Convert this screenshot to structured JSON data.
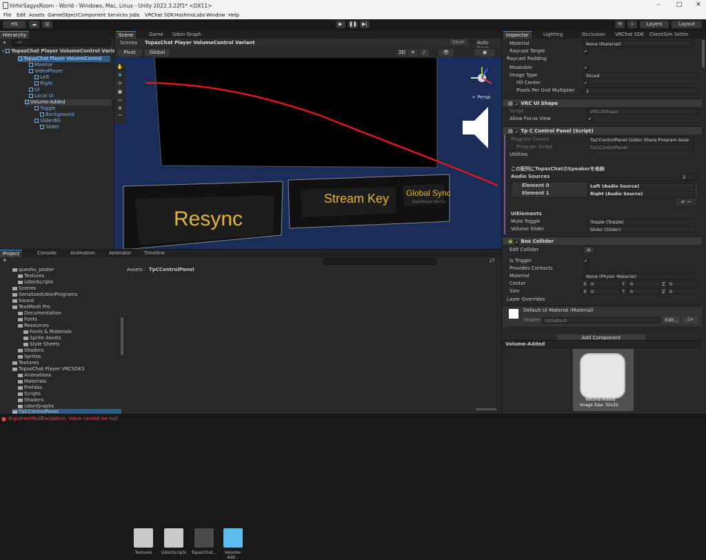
{
  "window": {
    "title": "hirhirSagyoRoom - World - Windows, Mac, Linux - Unity 2022.3.22f1* <DX11>"
  },
  "menu": [
    "File",
    "Edit",
    "Assets",
    "GameObject",
    "Component",
    "Services",
    "Jobs",
    "VRChat SDK",
    "HoshinoLabs",
    "Window",
    "Help"
  ],
  "toolbar": {
    "account": "HS",
    "layers": "Layers",
    "layout": "Layout"
  },
  "hierarchy": {
    "tab": "Hierarchy",
    "search_placeholder": "All",
    "root": "TopazChat Player VolumeControl Varia",
    "items": [
      "TopazChat Player VolumeControl",
      "Monitor",
      "VideoPlayer",
      "Left",
      "Right",
      "UI",
      "Local UI",
      "Volume-Added",
      "Toggle",
      "Background",
      "SliderBG",
      "Slider"
    ]
  },
  "scene": {
    "tabs": [
      "Scene",
      "Game",
      "Udon Graph"
    ],
    "breadcrumb_root": "Scenes",
    "breadcrumb": "TopazChat Player VolumeControl Variant",
    "save": "Save",
    "autosave": "Auto Save",
    "pivot": "Pivot",
    "global": "Global",
    "twod": "2D",
    "persp": "< Persp",
    "buttons": {
      "resync": "Resync",
      "stream_key": "Stream Key",
      "global_sync": "Global Sync",
      "version": "TopazPlayer Ver 3.x"
    }
  },
  "project": {
    "tabs": [
      "Project",
      "Console",
      "Animation",
      "Animator",
      "Timeline"
    ],
    "tree": [
      "queshu_poster",
      "Textures",
      "UdonScripts",
      "Scenes",
      "SerializedUdonPrograms",
      "Sound",
      "TextMesh Pro",
      "Documentation",
      "Fonts",
      "Resources",
      "Fonts & Materials",
      "Sprite Assets",
      "Style Sheets",
      "Shaders",
      "Sprites",
      "Textures",
      "TopazChat Player VRCSDK3",
      "Animations",
      "Materials",
      "Prefabs",
      "Scripts",
      "Shaders",
      "UdonGraphs",
      "TpCControlPanel"
    ],
    "path": [
      "Assets",
      "TpCControlPanel"
    ],
    "assets": [
      "Textures",
      "UdonScripts",
      "TopazChat...",
      "Volume-Add..."
    ],
    "count": "27"
  },
  "inspector": {
    "tabs": [
      "Inspector",
      "Lighting",
      "Occlusion",
      "VRChat SDK",
      "ClientSim Settin"
    ],
    "rows": {
      "material": "Material",
      "material_val": "None (Material)",
      "raycast_target": "Raycast Target",
      "raycast_padding": "Raycast Padding",
      "maskable": "Maskable",
      "image_type": "Image Type",
      "image_type_val": "Sliced",
      "fill_center": "Fill Center",
      "ppu": "Pixels Per Unit Multiplier",
      "ppu_val": "1"
    },
    "vrc_ui_shape": {
      "title": "VRC UI Shape",
      "script": "Script",
      "script_val": "VRCUIShape",
      "allow_focus": "Allow Focus View"
    },
    "tpc": {
      "title": "Tp C Control Panel (Script)",
      "program_source": "Program Source",
      "program_source_val": "TpCControlPanel (Udon Sharp Program Asse",
      "program_script": "Program Script",
      "program_script_val": "TpCControlPanel",
      "utilities": "Utilities",
      "note": "この配列にTopazChatのSpeakerを格納",
      "audio_sources": "Audio Sources",
      "audio_count": "2",
      "el0": "Element 0",
      "el0_val": "Left (Audio Source)",
      "el1": "Element 1",
      "el1_val": "Right (Audio Source)",
      "uielements": "UIElements",
      "mute": "Mute Toggle",
      "mute_val": "Toggle (Toggle)",
      "vol": "Volume Slider",
      "vol_val": "Slider (Slider)"
    },
    "box": {
      "title": "Box Collider",
      "edit": "Edit Collider",
      "trigger": "Is Trigger",
      "provides": "Provides Contacts",
      "material": "Material",
      "material_val": "None (Physic Material)",
      "center": "Center",
      "size": "Size",
      "layer": "Layer Overrides",
      "x": "X",
      "y": "Y",
      "z": "Z",
      "zero": "0"
    },
    "mat": {
      "title": "Default UI Material (Material)",
      "shader": "Shader",
      "shader_val": "UI/Default",
      "edit": "Edit..."
    },
    "add_component": "Add Component",
    "preview": {
      "name": "Volume-Added",
      "label": "Volume-Added",
      "size": "Image Size: 32x32"
    }
  },
  "status": {
    "error": "ArgumentNullException: Value cannot be null."
  }
}
